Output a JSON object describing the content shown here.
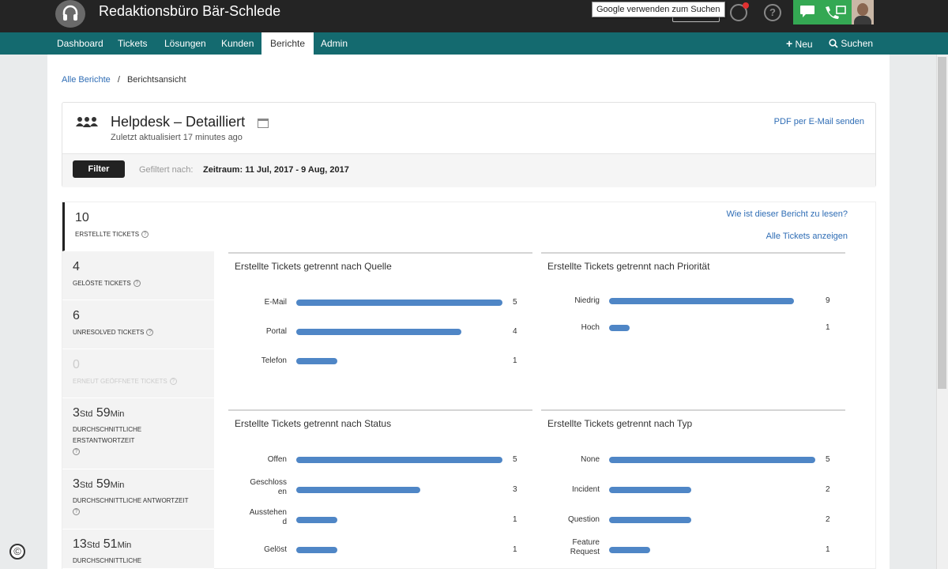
{
  "header": {
    "brand": "Redaktionsbüro Bär-Schlede",
    "tooltip": "Google verwenden zum Suchen"
  },
  "nav": {
    "items": [
      {
        "label": "Dashboard"
      },
      {
        "label": "Tickets"
      },
      {
        "label": "Lösungen"
      },
      {
        "label": "Kunden"
      },
      {
        "label": "Berichte"
      },
      {
        "label": "Admin"
      }
    ],
    "new_label": "Neu",
    "search_label": "Suchen"
  },
  "breadcrumb": {
    "root": "Alle Berichte",
    "separator": "/",
    "current": "Berichtsansicht"
  },
  "report": {
    "title": "Helpdesk – Detailliert",
    "updated": "Zuletzt aktualisiert 17 minutes ago",
    "pdf_link": "PDF per E-Mail senden",
    "filter_button": "Filter",
    "filtered_by": "Gefiltert nach:",
    "period_label": "Zeitraum:",
    "period_value": "11 Jul, 2017 - 9 Aug, 2017"
  },
  "stats": [
    {
      "value": "10",
      "label": "Erstellte Tickets"
    },
    {
      "value": "4",
      "label": "Gelöste Tickets"
    },
    {
      "value": "6",
      "label": "Unresolved Tickets"
    },
    {
      "value": "0",
      "label": "Erneut geöffnete Tickets"
    },
    {
      "h": "3",
      "h_unit": "Std",
      "m": "59",
      "m_unit": "Min",
      "label": "Durchschnittliche Erstantwortzeit"
    },
    {
      "h": "3",
      "h_unit": "Std",
      "m": "59",
      "m_unit": "Min",
      "label": "Durchschnittliche Antwortzeit"
    },
    {
      "h": "13",
      "h_unit": "Std",
      "m": "51",
      "m_unit": "Min",
      "label": "Durchschnittliche"
    }
  ],
  "links": {
    "help": "Wie ist dieser Bericht zu lesen?",
    "all_tickets": "Alle Tickets anzeigen"
  },
  "colors": {
    "bar": "#4f86c6",
    "nav": "#146a6f",
    "topbar": "#242424",
    "accent_green": "#34a853"
  },
  "chart_data": [
    {
      "type": "bar",
      "title": "Erstellte Tickets getrennt nach Quelle",
      "categories": [
        "E-Mail",
        "Portal",
        "Telefon"
      ],
      "values": [
        5,
        4,
        1
      ]
    },
    {
      "type": "bar",
      "title": "Erstellte Tickets getrennt nach Priorität",
      "categories": [
        "Niedrig",
        "Hoch"
      ],
      "values": [
        9,
        1
      ]
    },
    {
      "type": "bar",
      "title": "Erstellte Tickets getrennt nach Status",
      "categories": [
        "Offen",
        "Geschlossen",
        "Ausstehend",
        "Gelöst"
      ],
      "values": [
        5,
        3,
        1,
        1
      ]
    },
    {
      "type": "bar",
      "title": "Erstellte Tickets getrennt nach Typ",
      "categories": [
        "None",
        "Incident",
        "Question",
        "Feature Request"
      ],
      "values": [
        5,
        2,
        2,
        1
      ]
    }
  ]
}
